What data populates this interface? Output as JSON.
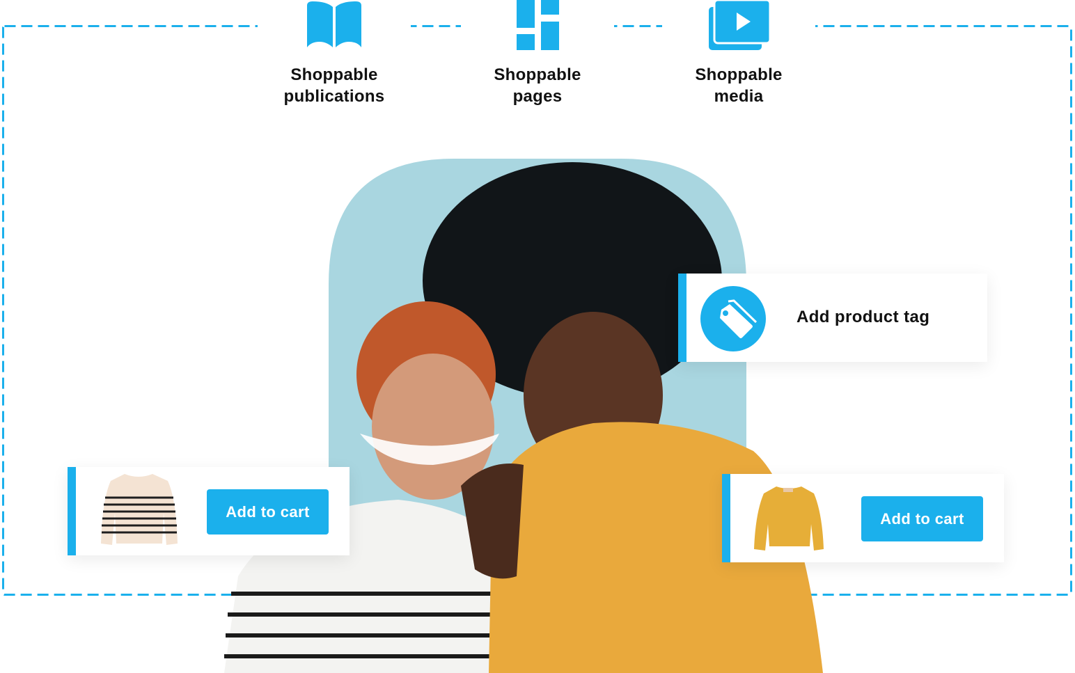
{
  "colors": {
    "accent": "#1bb0ec",
    "photo_background": "#a9d6e0",
    "text": "#111111",
    "button_text": "#ffffff"
  },
  "features": [
    {
      "icon": "book-icon",
      "line1": "Shoppable",
      "line2": "publications"
    },
    {
      "icon": "page-layout-icon",
      "line1": "Shoppable",
      "line2": "pages"
    },
    {
      "icon": "video-play-icon",
      "line1": "Shoppable",
      "line2": "media"
    }
  ],
  "hero_image": {
    "description": "Two smiling women posing together; one in a striped white top, one in a mustard knit sweater"
  },
  "product_tag_card": {
    "icon": "tag-icon",
    "label": "Add product tag"
  },
  "product_cards": [
    {
      "product": "Striped cream sweater",
      "button_label": "Add to cart"
    },
    {
      "product": "Mustard knit sweater",
      "button_label": "Add to cart"
    }
  ]
}
